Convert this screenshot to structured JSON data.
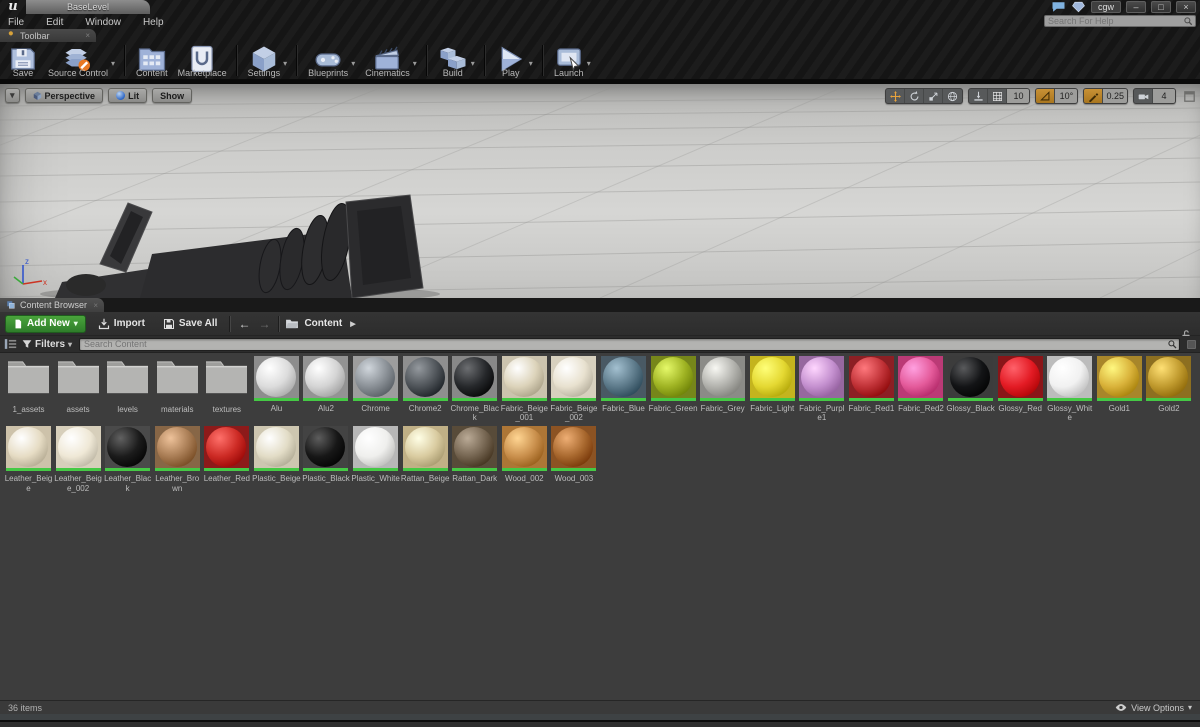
{
  "window": {
    "logo_glyph": "u",
    "tab_title": "BaseLevel",
    "user_badge": "cgw",
    "help_search_placeholder": "Search For Help",
    "controls": {
      "minimize": "–",
      "maximize": "□",
      "close": "×"
    }
  },
  "ui": {
    "caret": "▾",
    "breadcrumb_arrow": "▶",
    "tab_close": "×",
    "back_arrow": "←",
    "forward_arrow": "→"
  },
  "menu_bar": {
    "items": [
      {
        "label": "File"
      },
      {
        "label": "Edit"
      },
      {
        "label": "Window"
      },
      {
        "label": "Help"
      }
    ]
  },
  "toolbar": {
    "tab_label": "Toolbar",
    "buttons": [
      {
        "id": "save",
        "label": "Save",
        "icon": "save-icon",
        "dropdown": false,
        "group_end": false
      },
      {
        "id": "source-control",
        "label": "Source Control",
        "icon": "source-control-icon",
        "dropdown": true,
        "group_end": true
      },
      {
        "id": "content",
        "label": "Content",
        "icon": "content-icon",
        "dropdown": false,
        "group_end": false
      },
      {
        "id": "marketplace",
        "label": "Marketplace",
        "icon": "marketplace-icon",
        "dropdown": false,
        "group_end": true
      },
      {
        "id": "settings",
        "label": "Settings",
        "icon": "settings-icon",
        "dropdown": true,
        "group_end": true
      },
      {
        "id": "blueprints",
        "label": "Blueprints",
        "icon": "blueprints-icon",
        "dropdown": true,
        "group_end": false
      },
      {
        "id": "cinematics",
        "label": "Cinematics",
        "icon": "cinematics-icon",
        "dropdown": true,
        "group_end": true
      },
      {
        "id": "build",
        "label": "Build",
        "icon": "build-icon",
        "dropdown": true,
        "group_end": true
      },
      {
        "id": "play",
        "label": "Play",
        "icon": "play-icon",
        "dropdown": true,
        "group_end": true
      },
      {
        "id": "launch",
        "label": "Launch",
        "icon": "launch-icon",
        "dropdown": true,
        "group_end": false
      }
    ]
  },
  "viewport": {
    "mode_button": "Perspective",
    "lit_button": "Lit",
    "show_button": "Show",
    "snap": {
      "grid_value": "10",
      "angle_value": "10°",
      "scale_value": "0.25",
      "camera_speed": "4"
    },
    "axis_labels": {
      "x": "x",
      "z": "z"
    },
    "colors": {
      "axis_x": "#cc3322",
      "axis_y": "#3aa93a",
      "axis_z": "#3355cc",
      "snap_active": "#c89135"
    }
  },
  "content_browser": {
    "tab_label": "Content Browser",
    "add_new_label": "Add New",
    "import_label": "Import",
    "save_all_label": "Save All",
    "breadcrumb": "Content",
    "filters_label": "Filters",
    "search_placeholder": "Search Content",
    "status_text": "36 items",
    "view_options_label": "View Options",
    "material_bar_color": "#45c945",
    "assets": [
      {
        "name": "1_assets",
        "type": "folder"
      },
      {
        "name": "assets",
        "type": "folder"
      },
      {
        "name": "levels",
        "type": "folder"
      },
      {
        "name": "materials",
        "type": "folder"
      },
      {
        "name": "textures",
        "type": "folder"
      },
      {
        "name": "Alu",
        "type": "material",
        "bg": "#8d8d8d",
        "color": "#dcdcdc"
      },
      {
        "name": "Alu2",
        "type": "material",
        "bg": "#939393",
        "color": "#d4d4d4"
      },
      {
        "name": "Chrome",
        "type": "material",
        "bg": "#9d9d9d",
        "color": "#8a9096"
      },
      {
        "name": "Chrome2",
        "type": "material",
        "bg": "#8f8f8f",
        "color": "#4e5358"
      },
      {
        "name": "Chrome_Black",
        "type": "material",
        "bg": "#888888",
        "color": "#26282b"
      },
      {
        "name": "Fabric_Beige_001",
        "type": "material",
        "bg": "#cbc3ae",
        "color": "#dcd3ba"
      },
      {
        "name": "Fabric_Beige_002",
        "type": "material",
        "bg": "#d7d0be",
        "color": "#e8e1cf"
      },
      {
        "name": "Fabric_Blue",
        "type": "material",
        "bg": "#495964",
        "color": "#5d7a8a"
      },
      {
        "name": "Fabric_Green",
        "type": "material",
        "bg": "#76861a",
        "color": "#9fb323"
      },
      {
        "name": "Fabric_Grey",
        "type": "material",
        "bg": "#8b8b87",
        "color": "#b2b2ad"
      },
      {
        "name": "Fabric_Light",
        "type": "material",
        "bg": "#c4b41e",
        "color": "#e4d832"
      },
      {
        "name": "Fabric_Purple1",
        "type": "material",
        "bg": "#96689f",
        "color": "#c490cf"
      },
      {
        "name": "Fabric_Red1",
        "type": "material",
        "bg": "#8c1f24",
        "color": "#c03237"
      },
      {
        "name": "Fabric_Red2",
        "type": "material",
        "bg": "#bb3a76",
        "color": "#e45a9a"
      },
      {
        "name": "Glossy_Black",
        "type": "material",
        "bg": "#3c3c3c",
        "color": "#131416"
      },
      {
        "name": "Glossy_Red",
        "type": "material",
        "bg": "#8a1518",
        "color": "#e31b24"
      },
      {
        "name": "Glossy_White",
        "type": "material",
        "bg": "#bcbcbc",
        "color": "#f1f1f1"
      },
      {
        "name": "Gold1",
        "type": "material",
        "bg": "#a8862a",
        "color": "#d9b23a"
      },
      {
        "name": "Gold2",
        "type": "material",
        "bg": "#8d6f20",
        "color": "#c09a2e"
      },
      {
        "name": "Leather_Beige",
        "type": "material",
        "bg": "#cdc2aa",
        "color": "#e6dcc4"
      },
      {
        "name": "Leather_Beige_002",
        "type": "material",
        "bg": "#d7cfbb",
        "color": "#efe8d6"
      },
      {
        "name": "Leather_Black",
        "type": "material",
        "bg": "#4a4a4a",
        "color": "#1b1b1b"
      },
      {
        "name": "Leather_Brown",
        "type": "material",
        "bg": "#876646",
        "color": "#a87c54"
      },
      {
        "name": "Leather_Red",
        "type": "material",
        "bg": "#8d1a1a",
        "color": "#cc2a24"
      },
      {
        "name": "Plastic_Beige",
        "type": "material",
        "bg": "#cdc6b0",
        "color": "#e2dcc6"
      },
      {
        "name": "Plastic_Black",
        "type": "material",
        "bg": "#434343",
        "color": "#171717"
      },
      {
        "name": "Plastic_White",
        "type": "material",
        "bg": "#b7b7b7",
        "color": "#efefed"
      },
      {
        "name": "Rattan_Beige",
        "type": "material",
        "bg": "#c0b086",
        "color": "#d9cba0"
      },
      {
        "name": "Rattan_Dark",
        "type": "material",
        "bg": "#584b39",
        "color": "#746450"
      },
      {
        "name": "Wood_002",
        "type": "material",
        "bg": "#ad7636",
        "color": "#c98f4c"
      },
      {
        "name": "Wood_003",
        "type": "material",
        "bg": "#8c5323",
        "color": "#a8682e"
      }
    ]
  }
}
